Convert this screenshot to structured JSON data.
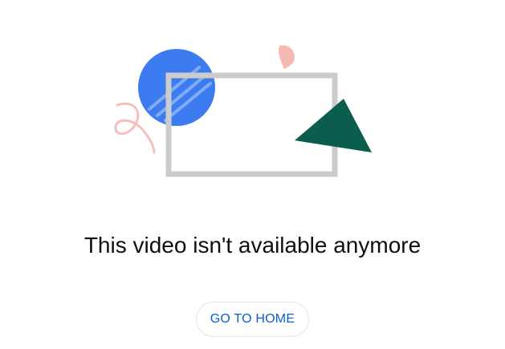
{
  "error": {
    "message": "This video isn't available anymore",
    "home_button_label": "GO TO HOME"
  },
  "illustration": {
    "colors": {
      "circle": "#3d7cf0",
      "circle_stripe": "#8fb4f7",
      "frame": "#cccccc",
      "triangle": "#0b5e4e",
      "squiggle": "#f5c0bc",
      "petal": "#f5b8b3"
    },
    "icons": [
      "blue-circle-icon",
      "screen-frame-icon",
      "green-triangle-icon",
      "pink-squiggle-icon",
      "pink-petal-icon"
    ]
  }
}
